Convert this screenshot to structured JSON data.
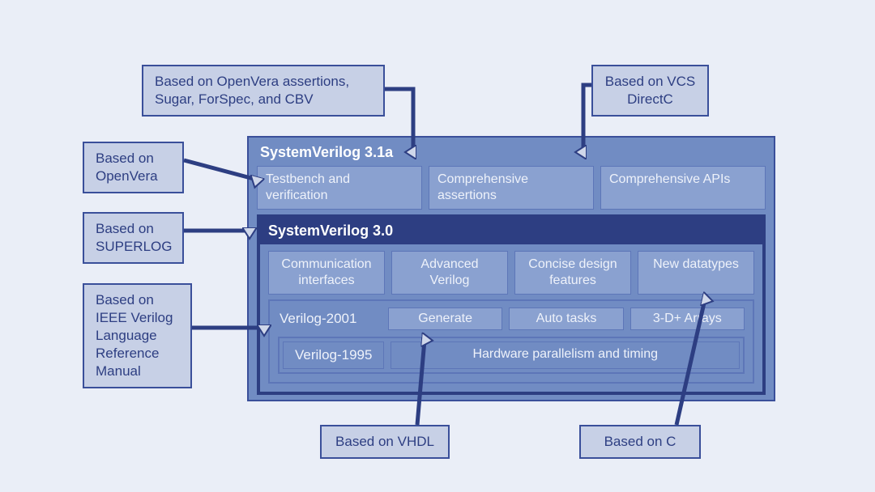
{
  "callouts": {
    "top_left": "Based on OpenVera  assertions, Sugar, ForSpec, and CBV",
    "top_right": "Based on VCS  DirectC",
    "openvera": "Based on OpenVera",
    "superlog": "Based on SUPERLOG",
    "ieee": "Based on IEEE Verilog Language Reference Manual",
    "vhdl": "Based on VHDL",
    "c": "Based on C"
  },
  "sv31a": {
    "title": "SystemVerilog 3.1a",
    "features": [
      "Testbench and verification",
      "Comprehensive assertions",
      "Comprehensive APIs"
    ]
  },
  "sv30": {
    "title": "SystemVerilog 3.0",
    "features": [
      "Communication interfaces",
      "Advanced Verilog",
      "Concise design features",
      "New datatypes"
    ]
  },
  "v2001": {
    "title": "Verilog-2001",
    "tags": [
      "Generate",
      "Auto tasks",
      "3-D+ Arrays"
    ]
  },
  "v1995": {
    "title": "Verilog-1995",
    "desc": "Hardware parallelism and timing"
  }
}
